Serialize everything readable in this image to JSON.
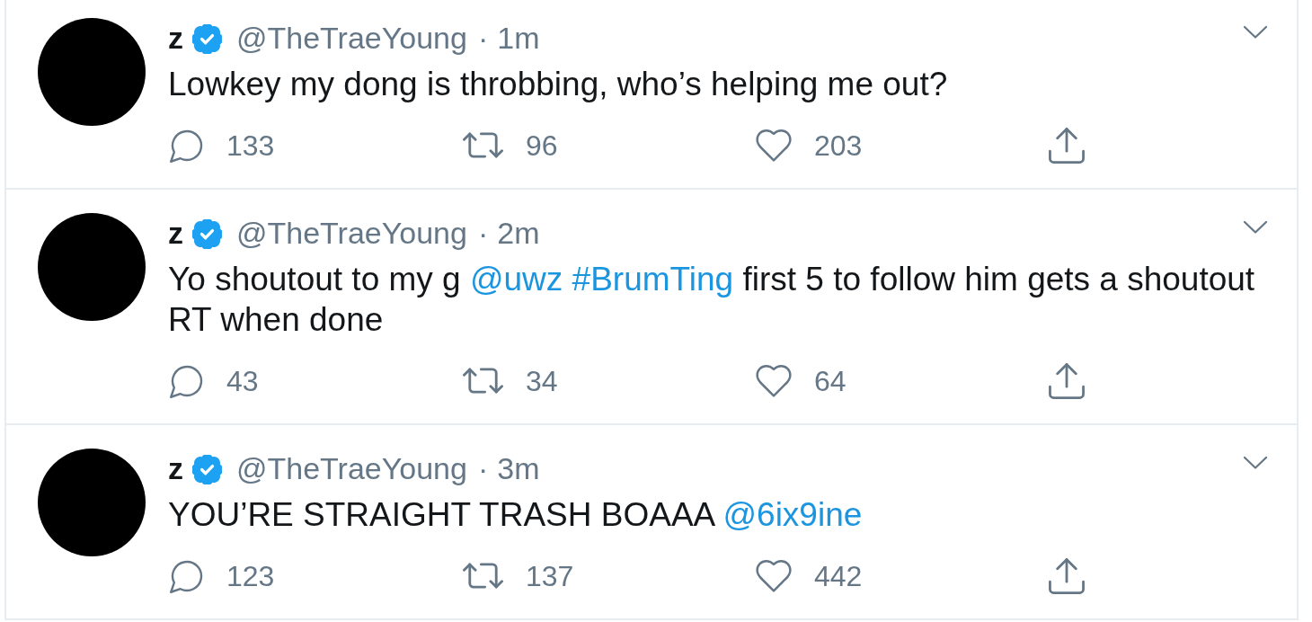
{
  "tweets": [
    {
      "author": {
        "name": "z",
        "verified": true,
        "handle": "@TheTraeYoung"
      },
      "separator": "·",
      "time": "1m",
      "text": [
        {
          "kind": "text",
          "text": "Lowkey my dong is throbbing, who’s helping me out?"
        }
      ],
      "actions": [
        {
          "kind": "reply",
          "count": "133"
        },
        {
          "kind": "retweet",
          "count": "96"
        },
        {
          "kind": "like",
          "count": "203"
        },
        {
          "kind": "share"
        }
      ]
    },
    {
      "author": {
        "name": "z",
        "verified": true,
        "handle": "@TheTraeYoung"
      },
      "separator": "·",
      "time": "2m",
      "text": [
        {
          "kind": "text",
          "text": "Yo shoutout to my g "
        },
        {
          "kind": "mention",
          "text": "@uwz "
        },
        {
          "kind": "hashtag",
          "text": "#BrumTing"
        },
        {
          "kind": "text",
          "text": " first 5 to follow him gets a shoutout RT when done"
        }
      ],
      "actions": [
        {
          "kind": "reply",
          "count": "43"
        },
        {
          "kind": "retweet",
          "count": "34"
        },
        {
          "kind": "like",
          "count": "64"
        },
        {
          "kind": "share"
        }
      ]
    },
    {
      "author": {
        "name": "z",
        "verified": true,
        "handle": "@TheTraeYoung"
      },
      "separator": "·",
      "time": "3m",
      "text": [
        {
          "kind": "text",
          "text": "YOU’RE STRAIGHT TRASH BOAAA "
        },
        {
          "kind": "mention",
          "text": "@6ix9ine"
        }
      ],
      "actions": [
        {
          "kind": "reply",
          "count": "123"
        },
        {
          "kind": "retweet",
          "count": "137"
        },
        {
          "kind": "like",
          "count": "442"
        },
        {
          "kind": "share"
        }
      ]
    }
  ]
}
